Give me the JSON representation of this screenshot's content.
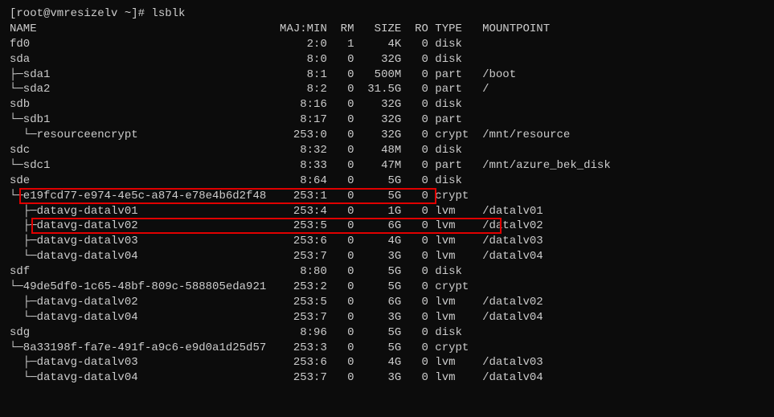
{
  "prompt": "[root@vmresizelv ~]# lsblk",
  "header": {
    "name": "NAME",
    "majmin": "MAJ:MIN",
    "rm": "RM",
    "size": "SIZE",
    "ro": "RO",
    "type": "TYPE",
    "mountpoint": "MOUNTPOINT"
  },
  "rows": [
    {
      "tree": "",
      "name": "fd0",
      "majmin": "2:0",
      "rm": "1",
      "size": "4K",
      "ro": "0",
      "type": "disk",
      "mountpoint": ""
    },
    {
      "tree": "",
      "name": "sda",
      "majmin": "8:0",
      "rm": "0",
      "size": "32G",
      "ro": "0",
      "type": "disk",
      "mountpoint": ""
    },
    {
      "tree": "├─",
      "name": "sda1",
      "majmin": "8:1",
      "rm": "0",
      "size": "500M",
      "ro": "0",
      "type": "part",
      "mountpoint": "/boot"
    },
    {
      "tree": "└─",
      "name": "sda2",
      "majmin": "8:2",
      "rm": "0",
      "size": "31.5G",
      "ro": "0",
      "type": "part",
      "mountpoint": "/"
    },
    {
      "tree": "",
      "name": "sdb",
      "majmin": "8:16",
      "rm": "0",
      "size": "32G",
      "ro": "0",
      "type": "disk",
      "mountpoint": ""
    },
    {
      "tree": "└─",
      "name": "sdb1",
      "majmin": "8:17",
      "rm": "0",
      "size": "32G",
      "ro": "0",
      "type": "part",
      "mountpoint": ""
    },
    {
      "tree": "  └─",
      "name": "resourceencrypt",
      "majmin": "253:0",
      "rm": "0",
      "size": "32G",
      "ro": "0",
      "type": "crypt",
      "mountpoint": "/mnt/resource"
    },
    {
      "tree": "",
      "name": "sdc",
      "majmin": "8:32",
      "rm": "0",
      "size": "48M",
      "ro": "0",
      "type": "disk",
      "mountpoint": ""
    },
    {
      "tree": "└─",
      "name": "sdc1",
      "majmin": "8:33",
      "rm": "0",
      "size": "47M",
      "ro": "0",
      "type": "part",
      "mountpoint": "/mnt/azure_bek_disk"
    },
    {
      "tree": "",
      "name": "sde",
      "majmin": "8:64",
      "rm": "0",
      "size": "5G",
      "ro": "0",
      "type": "disk",
      "mountpoint": ""
    },
    {
      "tree": "└─",
      "name": "e19fcd77-e974-4e5c-a874-e78e4b6d2f48",
      "majmin": "253:1",
      "rm": "0",
      "size": "5G",
      "ro": "0",
      "type": "crypt",
      "mountpoint": "",
      "hl": "1"
    },
    {
      "tree": "  ├─",
      "name": "datavg-datalv01",
      "majmin": "253:4",
      "rm": "0",
      "size": "1G",
      "ro": "0",
      "type": "lvm",
      "mountpoint": "/datalv01"
    },
    {
      "tree": "  ├─",
      "name": "datavg-datalv02",
      "majmin": "253:5",
      "rm": "0",
      "size": "6G",
      "ro": "0",
      "type": "lvm",
      "mountpoint": "/datalv02",
      "hl": "2"
    },
    {
      "tree": "  ├─",
      "name": "datavg-datalv03",
      "majmin": "253:6",
      "rm": "0",
      "size": "4G",
      "ro": "0",
      "type": "lvm",
      "mountpoint": "/datalv03"
    },
    {
      "tree": "  └─",
      "name": "datavg-datalv04",
      "majmin": "253:7",
      "rm": "0",
      "size": "3G",
      "ro": "0",
      "type": "lvm",
      "mountpoint": "/datalv04"
    },
    {
      "tree": "",
      "name": "sdf",
      "majmin": "8:80",
      "rm": "0",
      "size": "5G",
      "ro": "0",
      "type": "disk",
      "mountpoint": ""
    },
    {
      "tree": "└─",
      "name": "49de5df0-1c65-48bf-809c-588805eda921",
      "majmin": "253:2",
      "rm": "0",
      "size": "5G",
      "ro": "0",
      "type": "crypt",
      "mountpoint": ""
    },
    {
      "tree": "  ├─",
      "name": "datavg-datalv02",
      "majmin": "253:5",
      "rm": "0",
      "size": "6G",
      "ro": "0",
      "type": "lvm",
      "mountpoint": "/datalv02"
    },
    {
      "tree": "  └─",
      "name": "datavg-datalv04",
      "majmin": "253:7",
      "rm": "0",
      "size": "3G",
      "ro": "0",
      "type": "lvm",
      "mountpoint": "/datalv04"
    },
    {
      "tree": "",
      "name": "sdg",
      "majmin": "8:96",
      "rm": "0",
      "size": "5G",
      "ro": "0",
      "type": "disk",
      "mountpoint": ""
    },
    {
      "tree": "└─",
      "name": "8a33198f-fa7e-491f-a9c6-e9d0a1d25d57",
      "majmin": "253:3",
      "rm": "0",
      "size": "5G",
      "ro": "0",
      "type": "crypt",
      "mountpoint": ""
    },
    {
      "tree": "  ├─",
      "name": "datavg-datalv03",
      "majmin": "253:6",
      "rm": "0",
      "size": "4G",
      "ro": "0",
      "type": "lvm",
      "mountpoint": "/datalv03"
    },
    {
      "tree": "  └─",
      "name": "datavg-datalv04",
      "majmin": "253:7",
      "rm": "0",
      "size": "3G",
      "ro": "0",
      "type": "lvm",
      "mountpoint": "/datalv04"
    }
  ]
}
